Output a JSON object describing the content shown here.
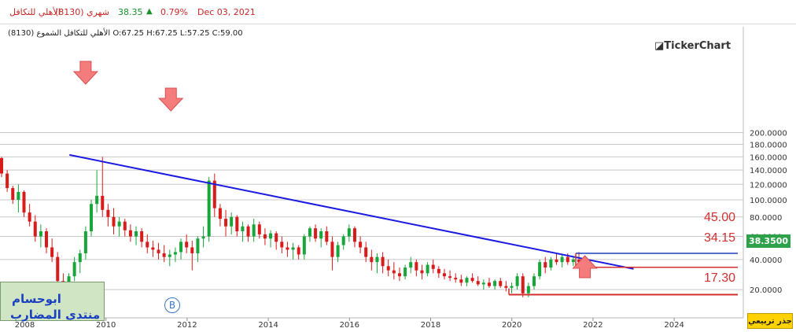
{
  "header": {
    "name": "الأهلي للتكافل",
    "code": "(8130)",
    "period": "شهري",
    "price": "38.35",
    "change": "0.79%",
    "date": "Dec 03, 2021",
    "up_color": "#1a8f2c"
  },
  "subheader": "الأهلي للتكافل الشموع (8130) O:67.25 H:67.25 L:57.25 C:59.00",
  "logo": "TickerChart",
  "watermark": {
    "line1": "ابوحسام",
    "line2": "منتدى المضارب"
  },
  "period_button": "جذر تربيعي",
  "price_badge": "38.3500",
  "marker_label": "B",
  "levels": [
    {
      "value": 45.0,
      "label": "45.00",
      "color": "#1f3fbf"
    },
    {
      "value": 34.15,
      "label": "34.15",
      "color": "#d32f2f"
    },
    {
      "value": 17.3,
      "label": "17.30",
      "color": "#d32f2f"
    }
  ],
  "chart_data": {
    "type": "candlestick",
    "scale": "sqrt",
    "y_ticks": [
      "200.0000",
      "180.0000",
      "160.0000",
      "140.0000",
      "120.0000",
      "100.0000",
      "80.0000",
      "60.0000",
      "40.0000",
      "20.0000"
    ],
    "x_ticks": [
      "2008",
      "2010",
      "2012",
      "2014",
      "2016",
      "2018",
      "2020",
      "2022",
      "2024"
    ],
    "up_color": "#18a63a",
    "down_color": "#d81b1b",
    "trendline": {
      "color": "#1a1ae0",
      "from": {
        "date": "2009.1",
        "value": 163
      },
      "to": {
        "date": "2023.0",
        "value": 33
      }
    },
    "arrows": [
      {
        "type": "down",
        "date": "2009.5"
      },
      {
        "type": "down",
        "date": "2011.6"
      },
      {
        "type": "up",
        "date": "2021.8"
      }
    ],
    "candles": [
      [
        158,
        160,
        130,
        135
      ],
      [
        135,
        140,
        110,
        115
      ],
      [
        115,
        118,
        95,
        100
      ],
      [
        100,
        120,
        85,
        110
      ],
      [
        110,
        112,
        80,
        85
      ],
      [
        85,
        95,
        70,
        75
      ],
      [
        75,
        82,
        55,
        60
      ],
      [
        60,
        72,
        50,
        65
      ],
      [
        65,
        68,
        45,
        50
      ],
      [
        50,
        58,
        38,
        42
      ],
      [
        42,
        46,
        22,
        25
      ],
      [
        25,
        30,
        14,
        18
      ],
      [
        18,
        30,
        15,
        28
      ],
      [
        28,
        42,
        25,
        38
      ],
      [
        38,
        48,
        30,
        45
      ],
      [
        45,
        70,
        40,
        65
      ],
      [
        65,
        100,
        60,
        95
      ],
      [
        95,
        140,
        85,
        105
      ],
      [
        105,
        160,
        80,
        88
      ],
      [
        88,
        95,
        70,
        80
      ],
      [
        80,
        90,
        62,
        70
      ],
      [
        70,
        80,
        60,
        75
      ],
      [
        75,
        78,
        60,
        66
      ],
      [
        66,
        72,
        55,
        60
      ],
      [
        60,
        70,
        52,
        65
      ],
      [
        65,
        68,
        50,
        55
      ],
      [
        55,
        62,
        45,
        50
      ],
      [
        50,
        56,
        42,
        48
      ],
      [
        48,
        54,
        40,
        45
      ],
      [
        45,
        52,
        38,
        42
      ],
      [
        42,
        48,
        35,
        44
      ],
      [
        44,
        50,
        38,
        46
      ],
      [
        46,
        58,
        40,
        55
      ],
      [
        55,
        62,
        45,
        50
      ],
      [
        50,
        56,
        32,
        45
      ],
      [
        45,
        60,
        38,
        58
      ],
      [
        58,
        70,
        50,
        60
      ],
      [
        60,
        130,
        55,
        125
      ],
      [
        125,
        135,
        80,
        90
      ],
      [
        90,
        95,
        70,
        78
      ],
      [
        78,
        88,
        60,
        70
      ],
      [
        70,
        85,
        62,
        80
      ],
      [
        80,
        82,
        60,
        65
      ],
      [
        65,
        75,
        55,
        70
      ],
      [
        70,
        72,
        55,
        60
      ],
      [
        60,
        78,
        55,
        72
      ],
      [
        72,
        75,
        58,
        62
      ],
      [
        62,
        68,
        52,
        58
      ],
      [
        58,
        66,
        50,
        63
      ],
      [
        63,
        65,
        48,
        55
      ],
      [
        55,
        60,
        45,
        50
      ],
      [
        50,
        55,
        42,
        48
      ],
      [
        48,
        54,
        40,
        50
      ],
      [
        50,
        52,
        40,
        44
      ],
      [
        44,
        62,
        40,
        60
      ],
      [
        60,
        70,
        55,
        68
      ],
      [
        68,
        72,
        55,
        58
      ],
      [
        58,
        68,
        50,
        65
      ],
      [
        65,
        70,
        52,
        55
      ],
      [
        55,
        60,
        32,
        42
      ],
      [
        42,
        55,
        38,
        52
      ],
      [
        52,
        62,
        48,
        60
      ],
      [
        60,
        72,
        55,
        68
      ],
      [
        68,
        70,
        50,
        55
      ],
      [
        55,
        60,
        45,
        50
      ],
      [
        50,
        55,
        38,
        42
      ],
      [
        42,
        48,
        32,
        38
      ],
      [
        38,
        45,
        30,
        42
      ],
      [
        42,
        46,
        30,
        35
      ],
      [
        35,
        40,
        28,
        32
      ],
      [
        32,
        38,
        26,
        30
      ],
      [
        30,
        34,
        25,
        28
      ],
      [
        28,
        36,
        26,
        34
      ],
      [
        34,
        42,
        30,
        38
      ],
      [
        38,
        40,
        28,
        32
      ],
      [
        32,
        36,
        26,
        30
      ],
      [
        30,
        38,
        28,
        36
      ],
      [
        36,
        40,
        30,
        33
      ],
      [
        33,
        35,
        27,
        30
      ],
      [
        30,
        33,
        26,
        28
      ],
      [
        28,
        32,
        25,
        27
      ],
      [
        27,
        30,
        24,
        26
      ],
      [
        26,
        29,
        22,
        24
      ],
      [
        24,
        28,
        22,
        27
      ],
      [
        27,
        30,
        24,
        25
      ],
      [
        25,
        28,
        22,
        23
      ],
      [
        23,
        26,
        20,
        24
      ],
      [
        24,
        27,
        21,
        22
      ],
      [
        22,
        26,
        20,
        25
      ],
      [
        25,
        27,
        21,
        22
      ],
      [
        22,
        25,
        19,
        21
      ],
      [
        21,
        24,
        18,
        22
      ],
      [
        22,
        30,
        20,
        28
      ],
      [
        28,
        30,
        16,
        18
      ],
      [
        18,
        24,
        16,
        22
      ],
      [
        22,
        30,
        20,
        28
      ],
      [
        28,
        40,
        26,
        38
      ],
      [
        38,
        42,
        30,
        34
      ],
      [
        34,
        42,
        32,
        40
      ],
      [
        40,
        45,
        36,
        38
      ],
      [
        38,
        44,
        34,
        42
      ],
      [
        42,
        45,
        36,
        38
      ],
      [
        38,
        42,
        35,
        40
      ],
      [
        40,
        46,
        34,
        38
      ]
    ]
  }
}
